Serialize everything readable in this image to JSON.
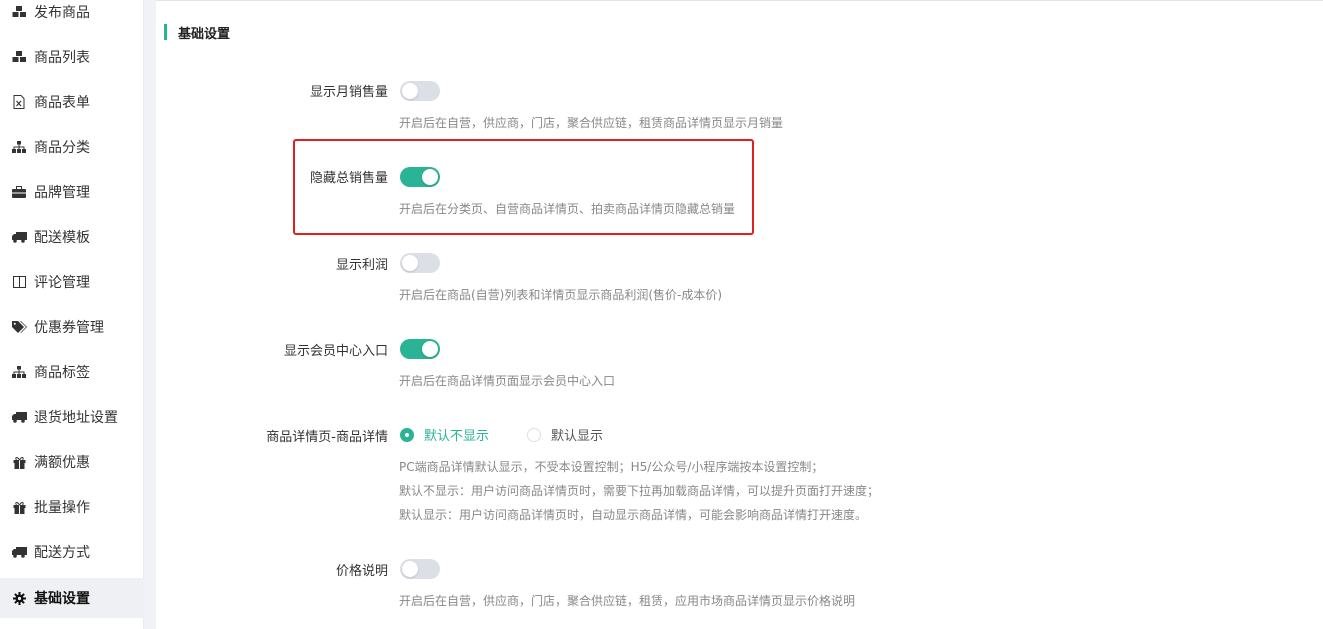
{
  "sidebar": {
    "items": [
      {
        "label": "发布商品",
        "icon": "cubes-icon"
      },
      {
        "label": "商品列表",
        "icon": "cubes-icon"
      },
      {
        "label": "商品表单",
        "icon": "excel-file-icon"
      },
      {
        "label": "商品分类",
        "icon": "sitemap-icon"
      },
      {
        "label": "品牌管理",
        "icon": "briefcase-icon"
      },
      {
        "label": "配送模板",
        "icon": "truck-icon"
      },
      {
        "label": "评论管理",
        "icon": "columns-icon"
      },
      {
        "label": "优惠券管理",
        "icon": "tags-icon"
      },
      {
        "label": "商品标签",
        "icon": "sitemap-icon"
      },
      {
        "label": "退货地址设置",
        "icon": "truck-icon"
      },
      {
        "label": "满额优惠",
        "icon": "gift-icon"
      },
      {
        "label": "批量操作",
        "icon": "gift-icon"
      },
      {
        "label": "配送方式",
        "icon": "truck-icon"
      },
      {
        "label": "基础设置",
        "icon": "gear-icon",
        "active": true
      }
    ]
  },
  "main": {
    "section_title": "基础设置",
    "settings": {
      "monthly_sales": {
        "label": "显示月销售量",
        "on": false,
        "desc": "开启后在自营，供应商，门店，聚合供应链，租赁商品详情页显示月销量"
      },
      "hide_total_sales": {
        "label": "隐藏总销售量",
        "on": true,
        "desc": "开启后在分类页、自营商品详情页、拍卖商品详情页隐藏总销量"
      },
      "show_profit": {
        "label": "显示利润",
        "on": false,
        "desc": "开启后在商品(自营)列表和详情页显示商品利润(售价-成本价)"
      },
      "member_center": {
        "label": "显示会员中心入口",
        "on": true,
        "desc": "开启后在商品详情页面显示会员中心入口"
      },
      "detail_display": {
        "label": "商品详情页-商品详情",
        "options": [
          {
            "label": "默认不显示",
            "checked": true
          },
          {
            "label": "默认显示",
            "checked": false
          }
        ],
        "desc_lines": [
          "PC端商品详情默认显示，不受本设置控制；H5/公众号/小程序端按本设置控制；",
          "默认不显示：用户访问商品详情页时，需要下拉再加载商品详情，可以提升页面打开速度；",
          "默认显示：用户访问商品详情页时，自动显示商品详情，可能会影响商品详情打开速度。"
        ]
      },
      "price_note": {
        "label": "价格说明",
        "on": false,
        "desc": "开启后在自营，供应商，门店，聚合供应链，租赁，应用市场商品详情页显示价格说明"
      }
    }
  },
  "colors": {
    "accent": "#2ab394",
    "highlight": "#e02020"
  }
}
